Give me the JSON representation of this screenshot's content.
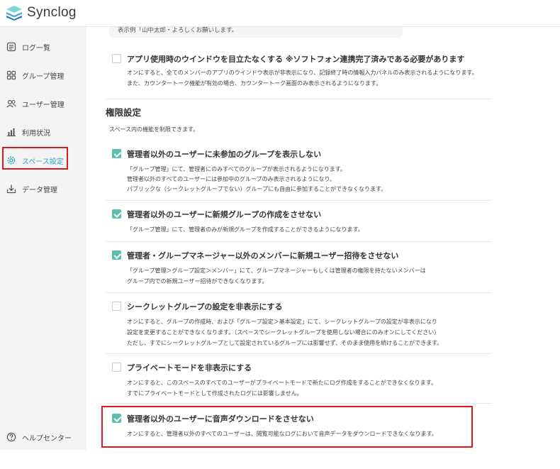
{
  "app": {
    "name": "Synclog"
  },
  "sidebar": {
    "items": [
      {
        "label": "ログ一覧",
        "icon": "log-list-icon"
      },
      {
        "label": "グループ管理",
        "icon": "group-icon"
      },
      {
        "label": "ユーザー管理",
        "icon": "users-icon"
      },
      {
        "label": "利用状況",
        "icon": "bar-chart-icon"
      },
      {
        "label": "スペース設定",
        "icon": "gear-icon",
        "active": true
      },
      {
        "label": "データ管理",
        "icon": "download-tray-icon"
      }
    ],
    "help": {
      "label": "ヘルプセンター",
      "icon": "help-circle-icon"
    }
  },
  "main": {
    "example_text": "表示例「山中太郎・よろしくお願いします。",
    "window_option": {
      "title": "アプリ使用時のウインドウを目立たなくする ※ソフトフォン連携完了済みである必要があります",
      "checked": false,
      "desc": [
        "オンにすると、全てのメンバーのアプリのウインドウ表示が非表示になり、記録終了時の情報入力パネルのみ表示されるようになります。",
        "また、カウンタートーク機能が有効の場合、カウンタートーク画面のみ表示されるようになります。"
      ]
    },
    "permissions": {
      "title": "権限設定",
      "desc": "スペース内の機能を制限できます。",
      "options": [
        {
          "title": "管理者以外のユーザーに未参加のグループを表示しない",
          "checked": true,
          "desc": [
            "「グループ管理」にて、管理者にのみすべてのグループが表示されるようになります。",
            "管理者以外のすべてのユーザーには参加中のグループのみ表示されるようになり、",
            "パブリックな（シークレットグループでない）グループにも自由に参加することができなくなります。"
          ]
        },
        {
          "title": "管理者以外のユーザーに新規グループの作成をさせない",
          "checked": true,
          "desc": [
            "「グループ管理」にて、管理者のみが新規グループを作成することができるようになります。"
          ]
        },
        {
          "title": "管理者・グループマネージャー以外のメンバーに新規ユーザー招待をさせない",
          "checked": true,
          "desc": [
            "「グループ管理＞グループ設定＞メンバー」にて、グループマネージャーもしくは管理者の権限を持たないメンバーは",
            "グループ内での新規ユーザー招待ができなくなります。"
          ]
        },
        {
          "title": "シークレットグループの設定を非表示にする",
          "checked": false,
          "desc": [
            "オンにすると、グループの作成時、および「グループ設定＞基本設定」にて、シークレットグループの設定が非表示になり",
            "設定を変更することができなくなります。（スペースでシークレットグループを使用しない場合にのみオンにしてください）",
            "ただし、すでにシークレットグループとして設定されているグループには影響せず、そのまま使用を続けることができます。"
          ]
        },
        {
          "title": "プライベートモードを非表示にする",
          "checked": false,
          "desc": [
            "オンにすると、このスペースのすべてのユーザーがプライベートモードで新たにログ作成をすることができなくなります。",
            "すでにプライベートモードとして作成されたログには影響しません。"
          ]
        },
        {
          "title": "管理者以外のユーザーに音声ダウンロードをさせない",
          "checked": true,
          "desc": [
            "オンにすると、管理者以外のすべてのユーザーは、閲覧可能なログにおいて音声データをダウンロードできなくなります。"
          ]
        }
      ]
    }
  },
  "colors": {
    "accent": "#2aa7c9",
    "checkbox": "#5cbfae",
    "highlight": "#e0191f"
  }
}
